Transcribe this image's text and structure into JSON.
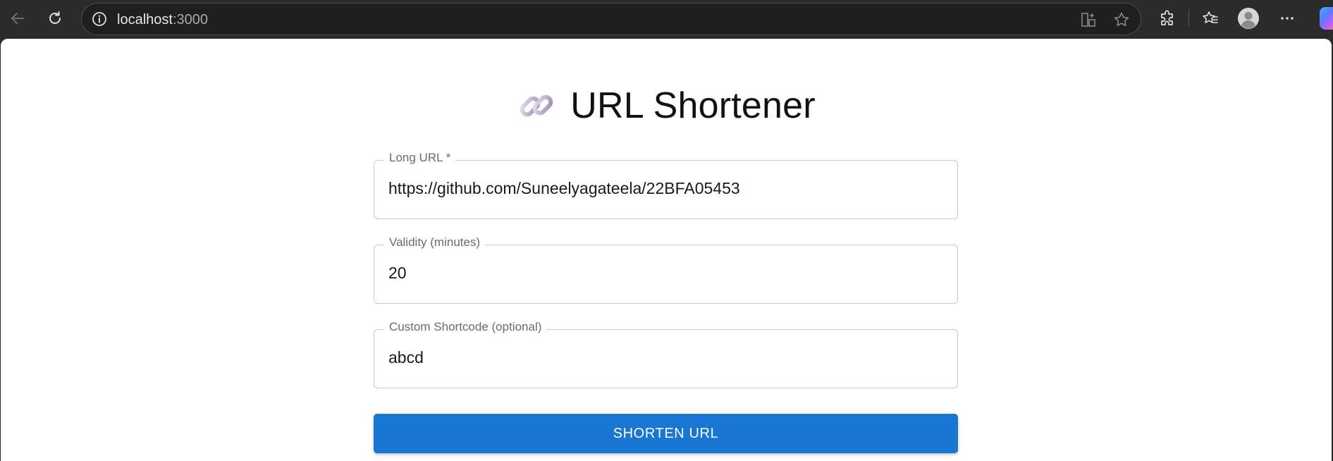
{
  "browser": {
    "url_host": "localhost",
    "url_port": ":3000",
    "icons": [
      "back-arrow-icon",
      "reload-icon",
      "info-icon",
      "split-screen-icon",
      "star-icon",
      "extensions-icon",
      "favorites-icon",
      "profile-icon",
      "more-icon",
      "copilot-icon"
    ]
  },
  "page": {
    "title_icon": "link-icon",
    "title": "URL Shortener",
    "fields": [
      {
        "label": "Long URL *",
        "value": "https://github.com/Suneelyagateela/22BFA05453"
      },
      {
        "label": "Validity (minutes)",
        "value": "20"
      },
      {
        "label": "Custom Shortcode (optional)",
        "value": "abcd"
      }
    ],
    "submit_label": "SHORTEN URL"
  },
  "colors": {
    "primary": "#1976d2",
    "chrome_bg": "#2b2b2b",
    "field_border": "#c9c9c9"
  }
}
